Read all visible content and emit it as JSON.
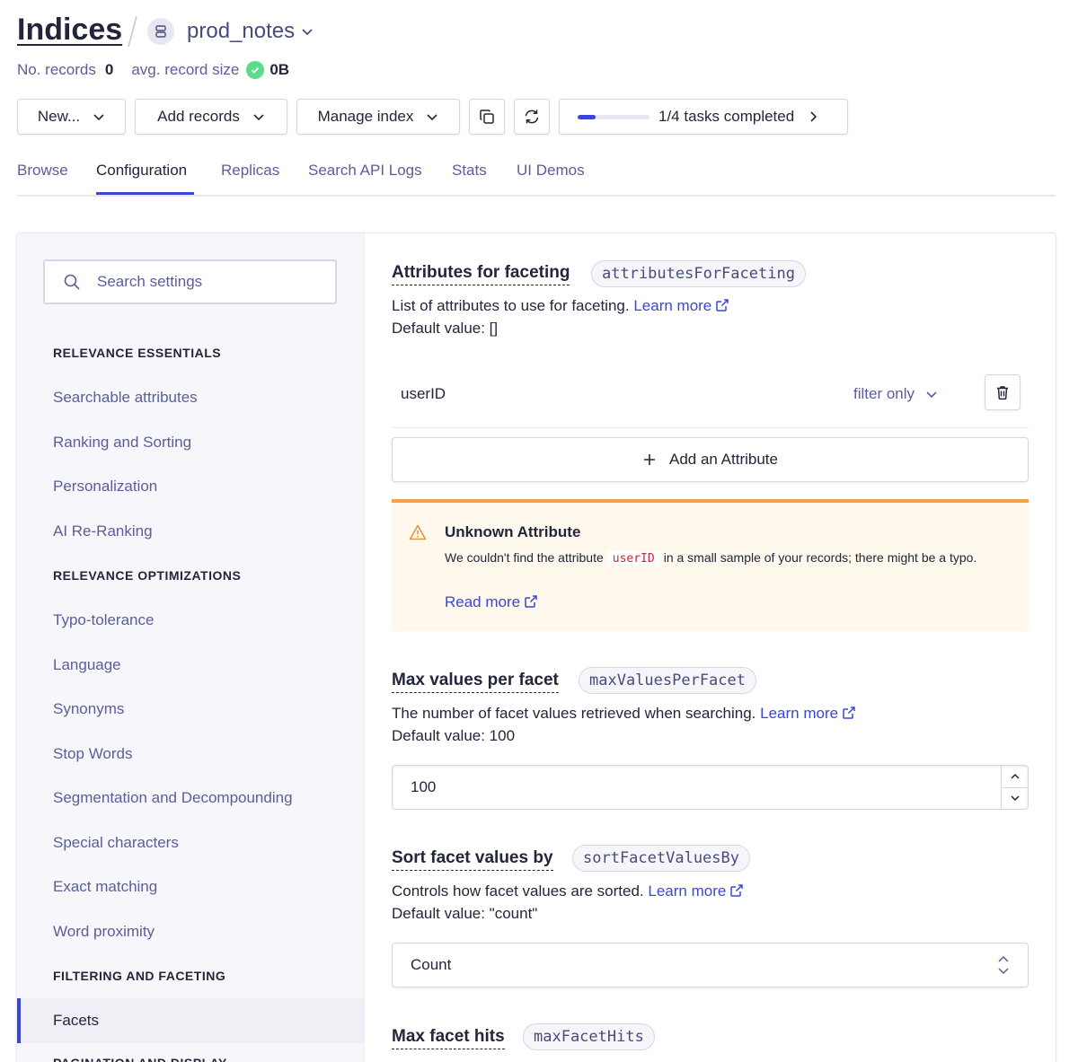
{
  "header": {
    "title": "Indices",
    "index_name": "prod_notes",
    "records_label": "No. records",
    "records_value": "0",
    "size_label": "avg. record size",
    "size_value": "0B"
  },
  "toolbar": {
    "new_label": "New...",
    "add_records_label": "Add records",
    "manage_index_label": "Manage index",
    "tasks_label": "1/4 tasks completed",
    "tasks_progress": 0.25
  },
  "tabs": [
    {
      "label": "Browse"
    },
    {
      "label": "Configuration"
    },
    {
      "label": "Replicas"
    },
    {
      "label": "Search API Logs"
    },
    {
      "label": "Stats"
    },
    {
      "label": "UI Demos"
    }
  ],
  "sidebar": {
    "search_placeholder": "Search settings",
    "sections": [
      {
        "heading": "RELEVANCE ESSENTIALS",
        "items": [
          "Searchable attributes",
          "Ranking and Sorting",
          "Personalization",
          "AI Re-Ranking"
        ]
      },
      {
        "heading": "RELEVANCE OPTIMIZATIONS",
        "items": [
          "Typo-tolerance",
          "Language",
          "Synonyms",
          "Stop Words",
          "Segmentation and Decompounding",
          "Special characters",
          "Exact matching",
          "Word proximity"
        ]
      },
      {
        "heading": "FILTERING AND FACETING",
        "items": [
          "Facets"
        ]
      }
    ],
    "active_item": "Facets"
  },
  "settings": {
    "facets": {
      "title": "Attributes for faceting",
      "key": "attributesForFaceting",
      "description": "List of attributes to use for faceting.",
      "learn_more": "Learn more",
      "default": "Default value: []",
      "attribute_name": "userID",
      "attribute_mode": "filter only",
      "add_label": "Add an Attribute"
    },
    "warning": {
      "title": "Unknown Attribute",
      "text_before": "We couldn't find the attribute",
      "code": "userID",
      "text_after": "in a small sample of your records; there might be a typo.",
      "link": "Read more"
    },
    "max_values": {
      "title": "Max values per facet",
      "key": "maxValuesPerFacet",
      "description": "The number of facet values retrieved when searching.",
      "learn_more": "Learn more",
      "default": "Default value: 100",
      "value": "100"
    },
    "sort_by": {
      "title": "Sort facet values by",
      "key": "sortFacetValuesBy",
      "description": "Controls how facet values are sorted.",
      "learn_more": "Learn more",
      "default": "Default value: \"count\"",
      "value": "Count"
    },
    "max_hits": {
      "title": "Max facet hits",
      "key": "maxFacetHits"
    }
  },
  "colors": {
    "accent": "#3a46d6",
    "warning": "#f5a14a",
    "success": "#5adc8a"
  }
}
